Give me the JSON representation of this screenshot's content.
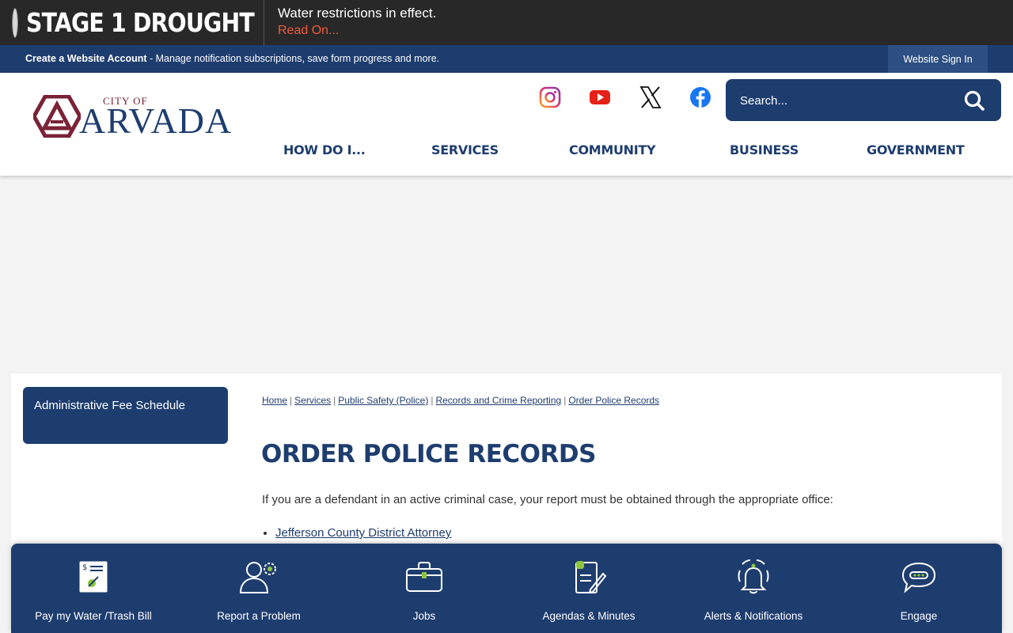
{
  "alert": {
    "title": "STAGE 1 DROUGHT",
    "message": "Water restrictions in effect.",
    "link": "Read On..."
  },
  "account_bar": {
    "create_label": "Create a Website Account",
    "description": " - Manage notification subscriptions, save form progress and more.",
    "signin_label": "Website Sign In"
  },
  "logo": {
    "city_of": "CITY OF",
    "name": "ARVADA"
  },
  "social": {
    "icons": [
      "instagram-icon",
      "youtube-icon",
      "x-icon",
      "facebook-icon"
    ]
  },
  "search": {
    "placeholder": "Search..."
  },
  "nav": {
    "items": [
      "HOW DO I...",
      "SERVICES",
      "COMMUNITY",
      "BUSINESS",
      "GOVERNMENT"
    ]
  },
  "sidebar": {
    "button_label": "Administrative Fee Schedule"
  },
  "breadcrumb": {
    "items": [
      "Home",
      "Services",
      "Public Safety (Police)",
      "Records and Crime Reporting",
      "Order Police Records"
    ],
    "separator": "|"
  },
  "main": {
    "title": "ORDER POLICE RECORDS",
    "intro": "If you are a defendant in an active criminal case, your report must be obtained through the appropriate office:",
    "links": [
      "Jefferson County District Attorney"
    ]
  },
  "quick_links": {
    "items": [
      {
        "label": "Pay my Water /Trash Bill",
        "icon": "bill-icon"
      },
      {
        "label": "Report a Problem",
        "icon": "person-gear-icon"
      },
      {
        "label": "Jobs",
        "icon": "briefcase-icon"
      },
      {
        "label": "Agendas & Minutes",
        "icon": "document-pen-icon"
      },
      {
        "label": "Alerts & Notifications",
        "icon": "bell-icon"
      },
      {
        "label": "Engage",
        "icon": "chat-bubble-icon"
      }
    ]
  },
  "colors": {
    "brand_navy": "#1e3d6f",
    "brand_maroon": "#7b2236",
    "alert_bg": "#282828",
    "alert_link": "#ef5a3c"
  }
}
